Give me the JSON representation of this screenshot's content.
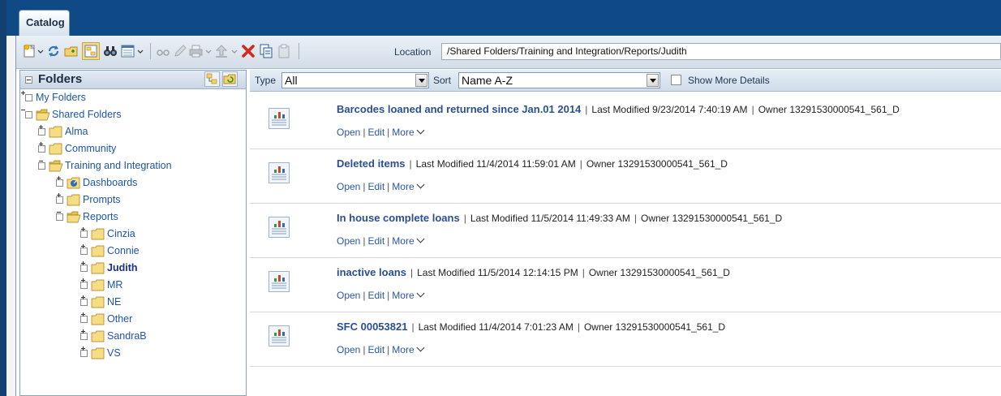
{
  "window": {
    "tab": "Catalog"
  },
  "toolbar": {
    "location_label": "Location",
    "location_value": "/Shared Folders/Training and Integration/Reports/Judith"
  },
  "folders": {
    "title": "Folders",
    "tree": [
      {
        "label": "My Folders",
        "expanded": false
      },
      {
        "label": "Shared Folders",
        "expanded": true
      },
      {
        "label": "Alma",
        "expanded": false
      },
      {
        "label": "Community",
        "expanded": false
      },
      {
        "label": "Training and Integration",
        "expanded": true
      },
      {
        "label": "Dashboards",
        "expanded": false
      },
      {
        "label": "Prompts",
        "expanded": false
      },
      {
        "label": "Reports",
        "expanded": true
      },
      {
        "label": "Cinzia",
        "expanded": false
      },
      {
        "label": "Connie",
        "expanded": false
      },
      {
        "label": "Judith",
        "expanded": false,
        "selected": true
      },
      {
        "label": "MR",
        "expanded": false
      },
      {
        "label": "NE",
        "expanded": false
      },
      {
        "label": "Other",
        "expanded": false
      },
      {
        "label": "SandraB",
        "expanded": false
      },
      {
        "label": "VS",
        "expanded": false
      }
    ]
  },
  "filter": {
    "type_label": "Type",
    "type_value": "All",
    "sort_label": "Sort",
    "sort_value": "Name A-Z",
    "details_label": "Show More Details",
    "details_checked": false
  },
  "items": [
    {
      "title": "Barcodes loaned and returned since Jan.01 2014",
      "modified": "Last Modified 9/23/2014 7:40:19 AM",
      "owner": "Owner 13291530000541_561_D"
    },
    {
      "title": "Deleted items",
      "modified": "Last Modified 11/4/2014 11:59:01 AM",
      "owner": "Owner 13291530000541_561_D"
    },
    {
      "title": "In house complete loans",
      "modified": "Last Modified 11/5/2014 11:49:33 AM",
      "owner": "Owner 13291530000541_561_D"
    },
    {
      "title": "inactive loans",
      "modified": "Last Modified 11/5/2014 12:14:15 PM",
      "owner": "Owner 13291530000541_561_D"
    },
    {
      "title": "SFC 00053821",
      "modified": "Last Modified 11/4/2014 7:01:23 AM",
      "owner": "Owner 13291530000541_561_D"
    }
  ],
  "actions": {
    "open": "Open",
    "edit": "Edit",
    "more": "More"
  }
}
